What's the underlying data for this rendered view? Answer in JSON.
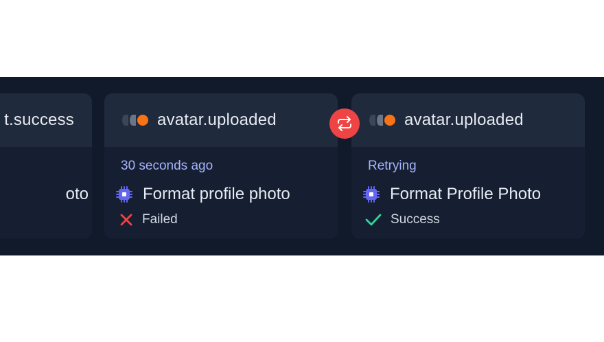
{
  "cards": [
    {
      "title": "t.success",
      "time": "",
      "step_label": "oto",
      "status_label": "",
      "status_icon": "none"
    },
    {
      "title": "avatar.uploaded",
      "time": "30 seconds ago",
      "step_label": "Format profile photo",
      "status_label": "Failed",
      "status_icon": "x-icon"
    },
    {
      "title": "avatar.uploaded",
      "time": "Retrying",
      "step_label": "Format Profile Photo",
      "status_label": "Success",
      "status_icon": "check-icon"
    }
  ],
  "retry_button": {
    "icon": "repeat-icon"
  },
  "colors": {
    "background": "#111a2b",
    "card": "#161f31",
    "card_header": "#1f2a3c",
    "accent_time": "#a5b4fc",
    "orange_dot": "#f97316",
    "failed": "#ef4444",
    "success": "#34d399",
    "chip": "#6366f1"
  }
}
